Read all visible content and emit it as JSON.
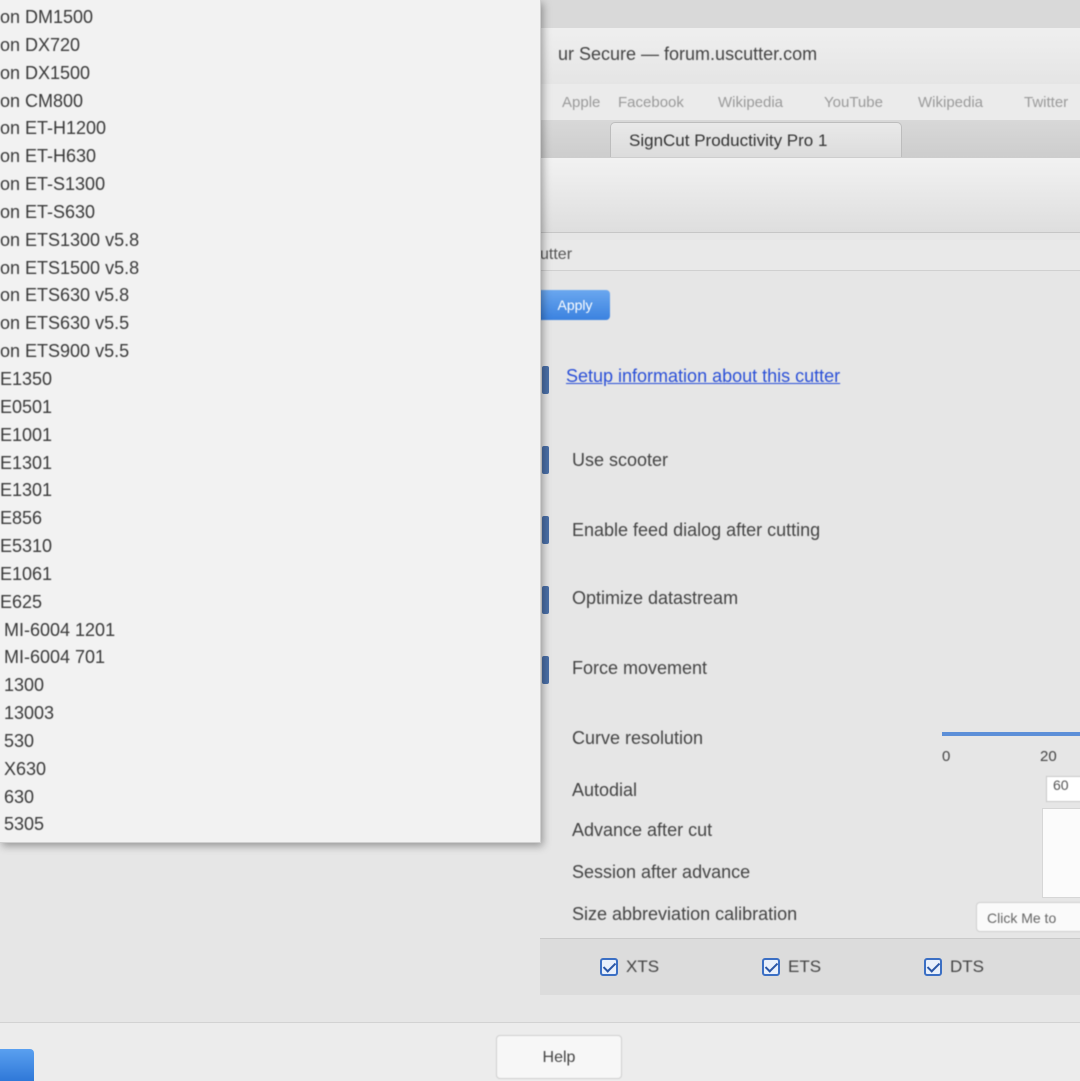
{
  "browser": {
    "address": "ur Secure — forum.uscutter.com",
    "bookmarks": [
      "Apple",
      "Facebook",
      "Wikipedia",
      "YouTube",
      "Wikipedia",
      "Twitter"
    ],
    "tab_title": "SignCut Productivity Pro 1"
  },
  "panel": {
    "header_label": "utter",
    "active_button": "Apply"
  },
  "settings": {
    "setup_link": "Setup information about this cutter",
    "use_scooter": "Use scooter",
    "feed_dialog": "Enable feed dialog after cutting",
    "optimize_datastream": "Optimize datastream",
    "force_movement": "Force movement",
    "curve_resolution": "Curve resolution",
    "curve_min": "0",
    "curve_mid": "20",
    "autodial": "Autodial",
    "autodial_value": "60",
    "advance_after_cut": "Advance after cut",
    "session_after_advance": "Session after advance",
    "size_calibration": "Size abbreviation calibration",
    "calib_value": "Click Me to"
  },
  "checks": [
    {
      "label": "XTS"
    },
    {
      "label": "ETS"
    },
    {
      "label": "DTS"
    }
  ],
  "bottom": {
    "button_label": "Help"
  },
  "dropdown": {
    "items": [
      "on DM1500",
      "on DX720",
      "on DX1500",
      "on CM800",
      "on ET-H1200",
      "on ET-H630",
      "on ET-S1300",
      "on ET-S630",
      "on ETS1300 v5.8",
      "on ETS1500 v5.8",
      "on ETS630 v5.8",
      "on ETS630 v5.5",
      "on ETS900 v5.5",
      "E1350",
      "E0501",
      "E1001",
      "E1301",
      "E1301",
      "E856",
      "E5310",
      "E1061",
      "E625",
      "MI-6004 1201",
      "MI-6004 701",
      "1300",
      "13003",
      "530",
      "X630",
      "630",
      "5305"
    ]
  }
}
